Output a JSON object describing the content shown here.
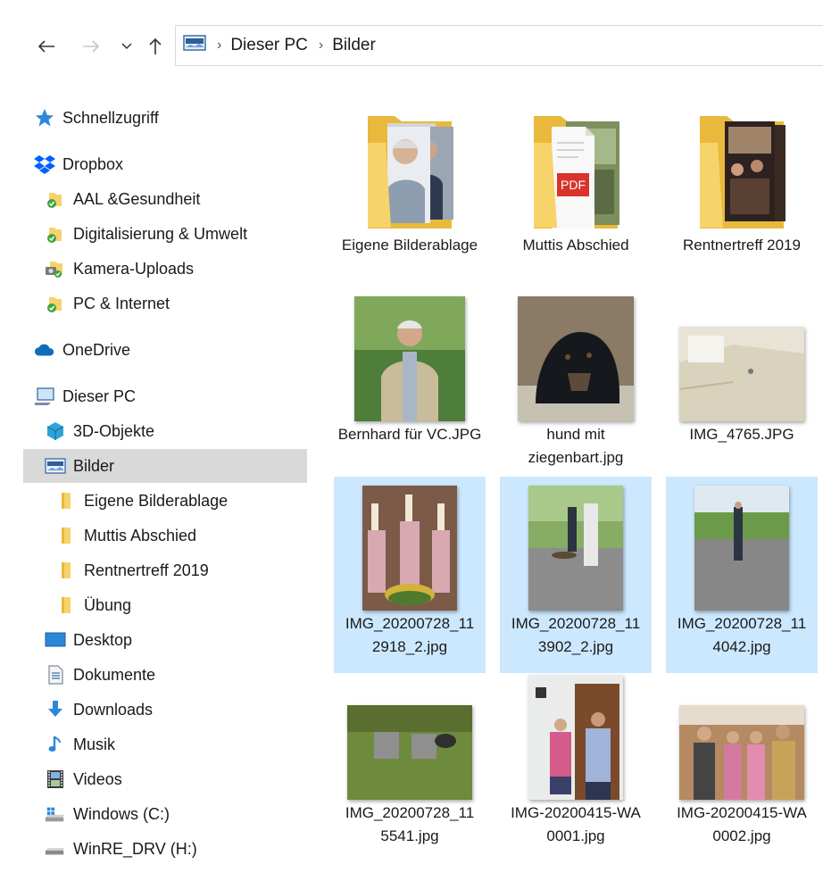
{
  "window": {
    "address": [
      "Dieser PC",
      "Bilder"
    ]
  },
  "sidebar": {
    "items": [
      {
        "label": "Schnellzugriff",
        "icon": "star-icon"
      },
      {
        "label": "Dropbox",
        "icon": "dropbox-icon"
      },
      {
        "label": "AAL &Gesundheit",
        "icon": "synced-folder-icon"
      },
      {
        "label": "Digitalisierung & Umwelt",
        "icon": "synced-folder-icon"
      },
      {
        "label": "Kamera-Uploads",
        "icon": "synced-camera-folder-icon"
      },
      {
        "label": "PC & Internet",
        "icon": "synced-folder-icon"
      },
      {
        "label": "OneDrive",
        "icon": "cloud-icon"
      },
      {
        "label": "Dieser PC",
        "icon": "computer-icon"
      },
      {
        "label": "3D-Objekte",
        "icon": "cube-icon"
      },
      {
        "label": "Bilder",
        "icon": "pictures-icon",
        "selected": true
      },
      {
        "label": "Eigene Bilderablage",
        "icon": "folder-icon"
      },
      {
        "label": "Muttis Abschied",
        "icon": "folder-icon"
      },
      {
        "label": "Rentnertreff 2019",
        "icon": "folder-icon"
      },
      {
        "label": "Übung",
        "icon": "folder-icon"
      },
      {
        "label": "Desktop",
        "icon": "desktop-icon"
      },
      {
        "label": "Dokumente",
        "icon": "documents-icon"
      },
      {
        "label": "Downloads",
        "icon": "download-arrow-icon"
      },
      {
        "label": "Musik",
        "icon": "music-note-icon"
      },
      {
        "label": "Videos",
        "icon": "film-icon"
      },
      {
        "label": "Windows (C:)",
        "icon": "drive-windows-icon"
      },
      {
        "label": "WinRE_DRV (H:)",
        "icon": "drive-icon"
      }
    ]
  },
  "files": [
    {
      "name": "Eigene Bilderablage",
      "kind": "folder"
    },
    {
      "name": "Muttis Abschied",
      "kind": "folder"
    },
    {
      "name": "Rentnertreff 2019",
      "kind": "folder"
    },
    {
      "name": "Bernhard für VC.JPG",
      "kind": "image"
    },
    {
      "name": "hund mit ziegenbart.jpg",
      "kind": "image"
    },
    {
      "name": "IMG_4765.JPG",
      "kind": "image"
    },
    {
      "name": "IMG_20200728_112918_2.jpg",
      "kind": "image",
      "selected": true
    },
    {
      "name": "IMG_20200728_113902_2.jpg",
      "kind": "image",
      "selected": true
    },
    {
      "name": "IMG_20200728_114042.jpg",
      "kind": "image",
      "selected": true
    },
    {
      "name": "IMG_20200728_115541.jpg",
      "kind": "image"
    },
    {
      "name": "IMG-20200415-WA0001.jpg",
      "kind": "image"
    },
    {
      "name": "IMG-20200415-WA0002.jpg",
      "kind": "image"
    }
  ],
  "thumb_texts": {
    "pdf": "PDF"
  },
  "colors": {
    "selection": "#cce8ff",
    "sidebar_selected": "#d9d9d9",
    "folder": "#f6d36b",
    "accent": "#0078d7"
  }
}
